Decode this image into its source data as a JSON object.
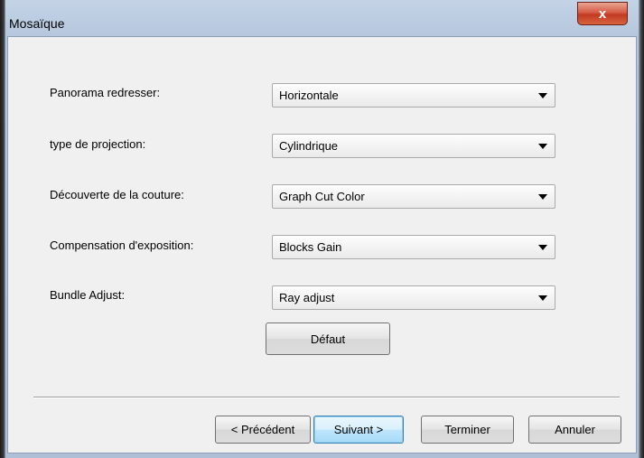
{
  "window": {
    "title": "Mosaïque",
    "close_label": "x"
  },
  "form": {
    "rows": [
      {
        "label": "Panorama redresser:",
        "value": "Horizontale"
      },
      {
        "label": "type de projection:",
        "value": "Cylindrique"
      },
      {
        "label": "Découverte de la couture:",
        "value": "Graph Cut Color"
      },
      {
        "label": "Compensation d'exposition:",
        "value": "Blocks Gain"
      },
      {
        "label": "Bundle Adjust:",
        "value": "Ray adjust"
      }
    ],
    "default_label": "Défaut"
  },
  "footer": {
    "previous_label": "< Précédent",
    "next_label": "Suivant >",
    "finish_label": "Terminer",
    "cancel_label": "Annuler"
  }
}
